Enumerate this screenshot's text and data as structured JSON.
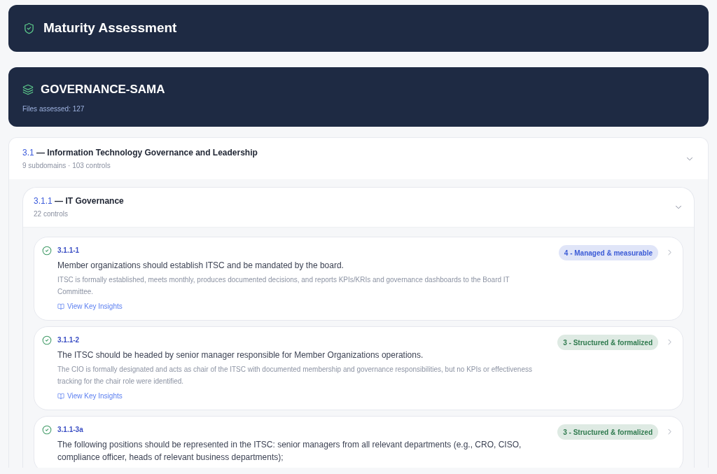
{
  "header": {
    "title": "Maturity Assessment"
  },
  "framework": {
    "name": "GOVERNANCE-SAMA",
    "files": "Files assessed: 127"
  },
  "domain": {
    "code": "3.1",
    "title": "— Information Technology Governance and Leadership",
    "meta": "9 subdomains · 103 controls",
    "expanded": true,
    "subdomains": [
      {
        "code": "3.1.1",
        "title": "— IT Governance",
        "meta": "22 controls",
        "expanded": true,
        "controls": [
          {
            "id": "3.1.1-1",
            "done": true,
            "requirement": "Member organizations should establish ITSC and be mandated by the board.",
            "finding": "ITSC is formally established, meets monthly, produces documented decisions, and reports KPIs/KRIs and governance dashboards to the Board IT Committee.",
            "link": "View Key Insights",
            "badge": {
              "text": "4 - Managed & measurable",
              "color": "#3b5bd6"
            }
          },
          {
            "id": "3.1.1-2",
            "done": true,
            "requirement": "The ITSC should be headed by senior manager responsible for Member Organizations operations.",
            "finding": "The CIO is formally designated and acts as chair of the ITSC with documented membership and governance responsibilities, but no KPIs or effectiveness tracking for the chair role were identified.",
            "link": "View Key Insights",
            "badge": {
              "text": "3 - Structured & formalized",
              "color": "#2f7a4e"
            }
          },
          {
            "id": "3.1.1-3a",
            "done": true,
            "requirement": "The following positions should be represented in the ITSC: senior managers from all relevant departments (e.g., CRO, CISO, compliance officer, heads of relevant business departments);",
            "badge": {
              "text": "3 - Structured & formalized",
              "color": "#2f7a4e"
            }
          }
        ]
      }
    ]
  }
}
